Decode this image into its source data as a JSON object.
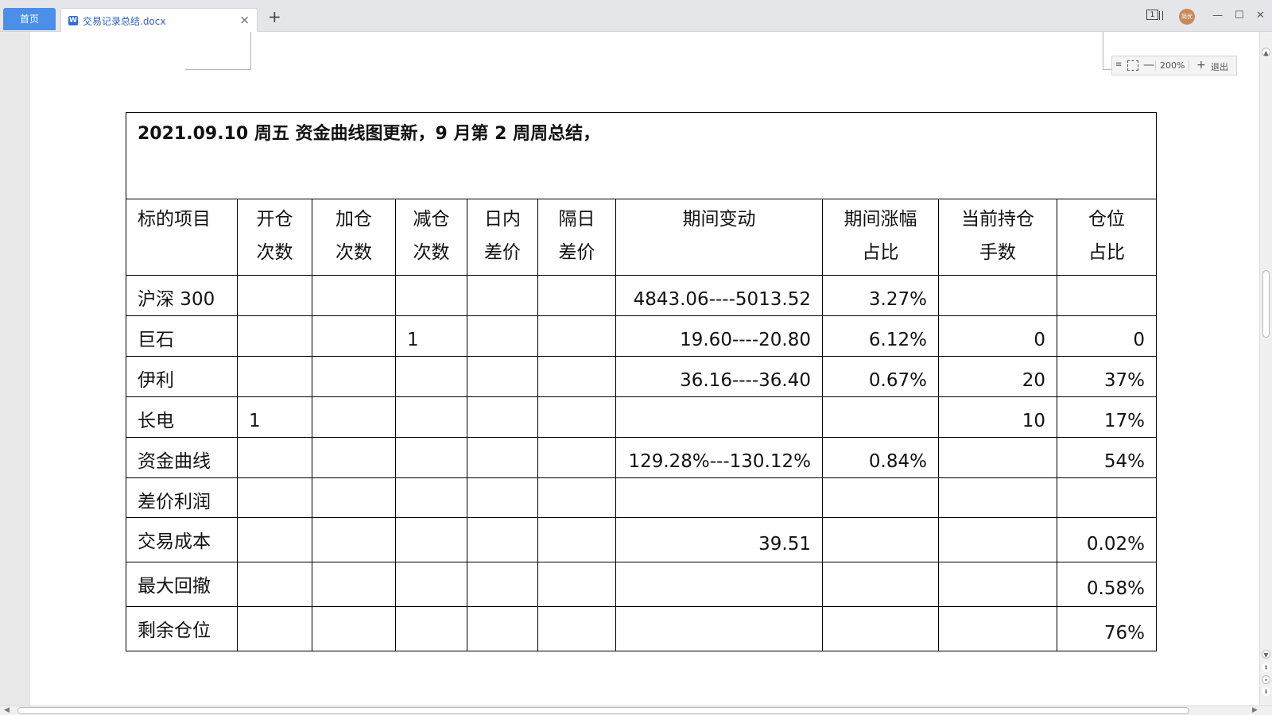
{
  "tabs": {
    "home_label": "首页",
    "doc_title": "交易记录总结.docx",
    "doc_icon": "W",
    "close_glyph": "×",
    "add_glyph": "+"
  },
  "window": {
    "page_count": "1",
    "avatar_text": "简优",
    "minimize": "—",
    "maximize": "☐",
    "close": "✕"
  },
  "zoom": {
    "menu": "≡",
    "minus": "—",
    "value": "200%",
    "plus": "+",
    "exit": "退出"
  },
  "table": {
    "title": "2021.09.10  周五  资金曲线图更新，9 月第 2 周周总结，",
    "headers": [
      [
        "标的项目",
        ""
      ],
      [
        "开仓",
        "次数"
      ],
      [
        "加仓",
        "次数"
      ],
      [
        "减仓",
        "次数"
      ],
      [
        "日内",
        "差价"
      ],
      [
        "隔日",
        "差价"
      ],
      [
        "期间变动",
        ""
      ],
      [
        "期间涨幅",
        "占比"
      ],
      [
        "当前持仓",
        "手数"
      ],
      [
        "仓位",
        "占比"
      ]
    ],
    "rows": [
      [
        "沪深 300",
        "",
        "",
        "",
        "",
        "",
        "4843.06----5013.52",
        "3.27%",
        "",
        ""
      ],
      [
        "巨石",
        "",
        "",
        "1",
        "",
        "",
        "19.60----20.80",
        "6.12%",
        "0",
        "0"
      ],
      [
        "伊利",
        "",
        "",
        "",
        "",
        "",
        "36.16----36.40",
        "0.67%",
        "20",
        "37%"
      ],
      [
        "长电",
        "1",
        "",
        "",
        "",
        "",
        "",
        "",
        "10",
        "17%"
      ],
      [
        "资金曲线",
        "",
        "",
        "",
        "",
        "",
        "129.28%---130.12%",
        "0.84%",
        "",
        "54%"
      ],
      [
        "差价利润",
        "",
        "",
        "",
        "",
        "",
        "",
        "",
        "",
        ""
      ],
      [
        "交易成本",
        "",
        "",
        "",
        "",
        "",
        "39.51",
        "",
        "",
        "0.02%"
      ],
      [
        "最大回撤",
        "",
        "",
        "",
        "",
        "",
        "",
        "",
        "",
        "0.58%"
      ],
      [
        "剩余仓位",
        "",
        "",
        "",
        "",
        "",
        "",
        "",
        "",
        "76%"
      ]
    ]
  }
}
